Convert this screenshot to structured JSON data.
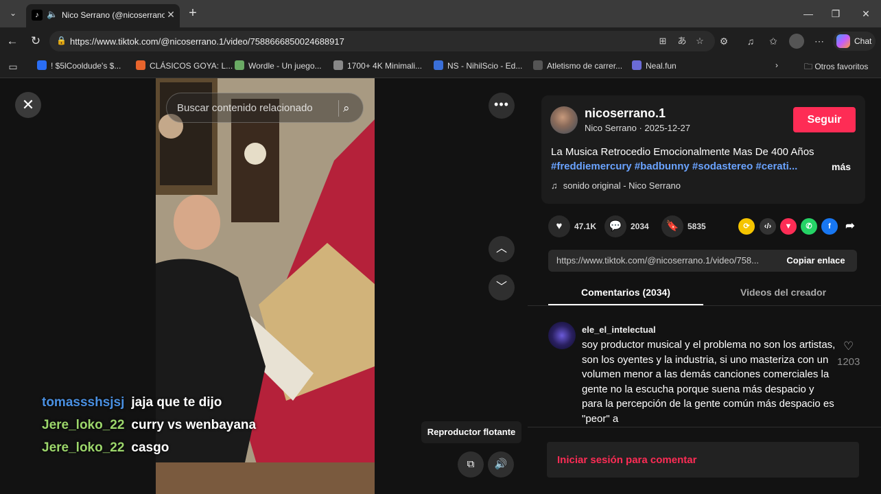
{
  "browser": {
    "tab_title": "Nico Serrano (@nicoserrano.1",
    "url": "https://www.tiktok.com/@nicoserrano.1/video/7588666850024688917",
    "chat_label": "Chat",
    "bookmarks": [
      {
        "label": "! $5lCooldude's $...",
        "color": "#2a6df4"
      },
      {
        "label": "CLÁSICOS GOYA: L...",
        "color": "#e8642c"
      },
      {
        "label": "Wordle - Un juego...",
        "color": "#6aaa64"
      },
      {
        "label": "1700+ 4K Minimali...",
        "color": "#888888"
      },
      {
        "label": "NS - NihilScio - Ed...",
        "color": "#3a6fd8"
      },
      {
        "label": "Atletismo de carrer...",
        "color": "#555555"
      },
      {
        "label": "Neal.fun",
        "color": "#6b6bd6"
      }
    ],
    "other_favorites": "Otros favoritos"
  },
  "player": {
    "search_placeholder": "Buscar contenido relacionado",
    "tooltip": "Reproductor flotante"
  },
  "chat_overlay": [
    {
      "user": "tomassshsjsj",
      "message": "jaja que te dijo",
      "color": "#4a90e2"
    },
    {
      "user": "Jere_loko_22",
      "message": "curry vs wenbayana",
      "color": "#9cd66b"
    },
    {
      "user": "Jere_loko_22",
      "message": "casgo",
      "color": "#9cd66b"
    }
  ],
  "video_info": {
    "username": "nicoserrano.1",
    "nickname_date": "Nico Serrano · 2025-12-27",
    "follow_label": "Seguir",
    "description": "La Musica Retrocedio Emocionalmente Mas De 400 Años",
    "hashtags": "#freddiemercury #badbunny #sodastereo #cerati...",
    "more_label": "más",
    "music": "sonido original - Nico Serrano",
    "likes": "47.1K",
    "comments": "2034",
    "saves": "5835",
    "share_link": "https://www.tiktok.com/@nicoserrano.1/video/758...",
    "copy_label": "Copiar enlace"
  },
  "tabs": {
    "comments": "Comentarios (2034)",
    "creator_videos": "Videos del creador"
  },
  "comment": {
    "user": "ele_el_intelectual",
    "text": "soy productor musical y el problema no son los artistas, son los oyentes y la industria, si uno masteriza con un volumen menor a las demás canciones comerciales la gente no la escucha porque suena más despacio y para la percepción de la gente común más despacio es \"peor\" a",
    "likes": "1203"
  },
  "login_prompt": "Iniciar sesión para comentar",
  "colors": {
    "accent": "#fe2c55",
    "hashtag": "#6aa3ff"
  }
}
